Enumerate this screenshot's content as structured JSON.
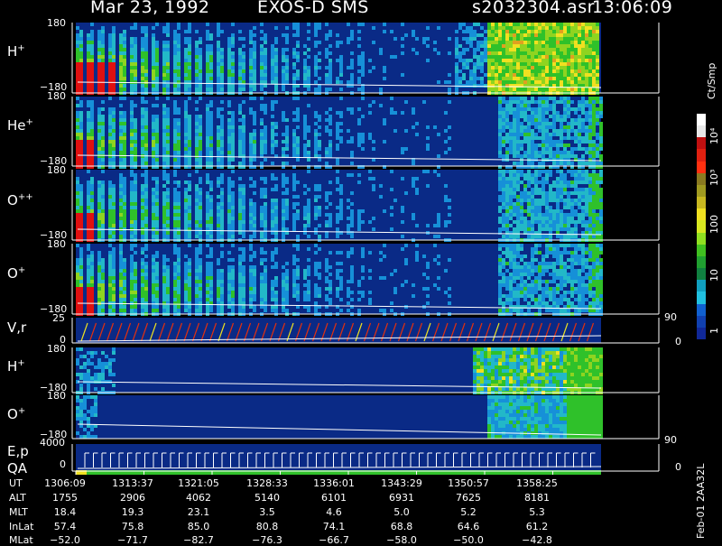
{
  "header": {
    "date": "Mar 23, 1992",
    "instrument": "EXOS-D SMS",
    "file": "s2032304.asr",
    "time": "13:06:09"
  },
  "panels": [
    {
      "name": "H",
      "sup": "+",
      "ytop": "180",
      "ybot": "−180"
    },
    {
      "name": "He",
      "sup": "+",
      "ytop": "180",
      "ybot": "−180"
    },
    {
      "name": "O",
      "sup": "++",
      "ytop": "180",
      "ybot": "−180"
    },
    {
      "name": "O",
      "sup": "+",
      "ytop": "180",
      "ybot": "−180"
    }
  ],
  "vr_panel": {
    "label": "V,r",
    "ytop": "25",
    "ybot": "0",
    "rtop": "90",
    "rbot": "0"
  },
  "lower_panels": [
    {
      "name": "H",
      "sup": "+",
      "ytop": "180",
      "ybot": "−180"
    },
    {
      "name": "O",
      "sup": "+",
      "ytop": "180",
      "ybot": "−180"
    }
  ],
  "ep_panel": {
    "label": "E,p",
    "label2": "QA",
    "ytop": "4000",
    "ybot": "0",
    "rtop": "90",
    "rbot": "0"
  },
  "colorbar": {
    "unit": "Ct/Smp",
    "ticks": [
      "10⁴",
      "10³",
      "100",
      "10",
      "1"
    ]
  },
  "side_note": "Feb-01 2AA32L",
  "table": {
    "rows": [
      {
        "label": "UT",
        "values": [
          "1306:09",
          "1313:37",
          "1321:05",
          "1328:33",
          "1336:01",
          "1343:29",
          "1350:57",
          "1358:25"
        ]
      },
      {
        "label": "ALT",
        "values": [
          "1755",
          "2906",
          "4062",
          "5140",
          "6101",
          "6931",
          "7625",
          "8181"
        ]
      },
      {
        "label": "MLT",
        "values": [
          "18.4",
          "19.3",
          "23.1",
          "3.5",
          "4.6",
          "5.0",
          "5.2",
          "5.3"
        ]
      },
      {
        "label": "InLat",
        "values": [
          "57.4",
          "75.8",
          "85.0",
          "80.8",
          "74.1",
          "68.8",
          "64.6",
          "61.2"
        ]
      },
      {
        "label": "MLat",
        "values": [
          "−52.0",
          "−71.7",
          "−82.7",
          "−76.3",
          "−66.7",
          "−58.0",
          "−50.0",
          "−42.8"
        ]
      }
    ]
  },
  "colors": {
    "background": "#0a2a86",
    "accent_low": "#0b5fd0",
    "green": "#2fc12a",
    "yellow": "#f0e020",
    "red": "#e01010",
    "white_trace": "#ffffff"
  }
}
